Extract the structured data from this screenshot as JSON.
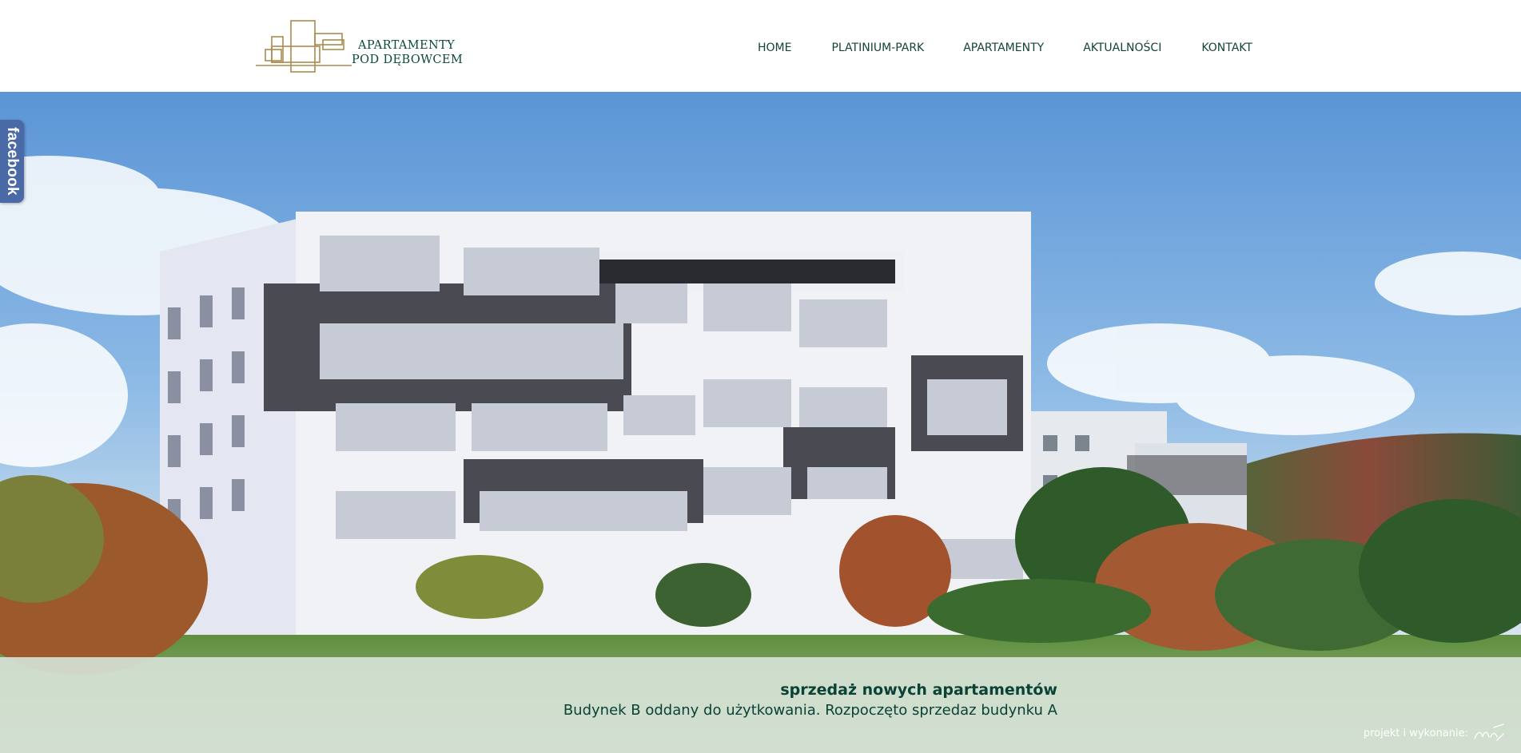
{
  "header": {
    "logo": {
      "line1": "APARTAMENTY",
      "line2": "POD DĘBOWCEM"
    },
    "nav": [
      {
        "label": "HOME"
      },
      {
        "label": "PLATINIUM-PARK"
      },
      {
        "label": "APARTAMENTY"
      },
      {
        "label": "AKTUALNOŚCI"
      },
      {
        "label": "KONTAKT"
      }
    ]
  },
  "social": {
    "facebook_label": "facebook"
  },
  "hero": {
    "banner_title": "sprzedaż nowych apartamentów",
    "banner_subtitle": "Budynek B oddany do użytkowania. Rozpoczęto sprzedaz budynku A"
  },
  "footer": {
    "credit": "projekt i wykonanie:"
  },
  "colors": {
    "brand_green": "#0b4a37",
    "brand_gold": "#a98c4d",
    "facebook_blue": "#4a6aa7",
    "band_bg": "#d6e2d6"
  }
}
